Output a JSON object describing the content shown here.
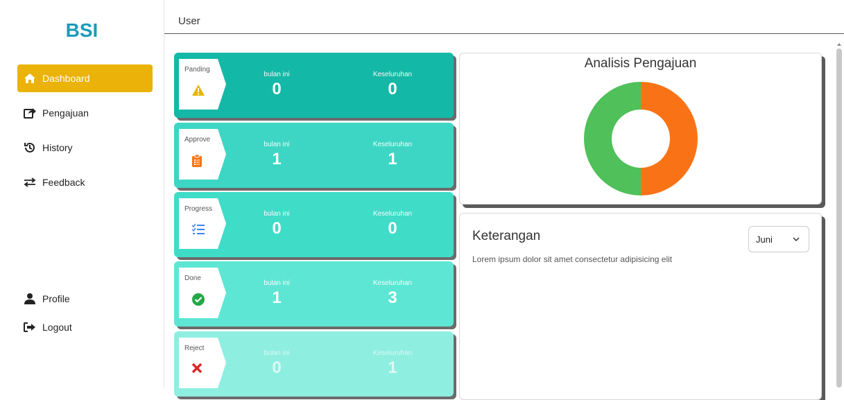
{
  "app": {
    "logo": "BSI",
    "user": "User"
  },
  "sidebar": {
    "items": [
      {
        "label": "Dashboard",
        "icon": "home-icon",
        "active": true
      },
      {
        "label": "Pengajuan",
        "icon": "share-icon",
        "active": false
      },
      {
        "label": "History",
        "icon": "history-icon",
        "active": false
      },
      {
        "label": "Feedback",
        "icon": "exchange-icon",
        "active": false
      }
    ],
    "bottom": [
      {
        "label": "Profile",
        "icon": "user-icon"
      },
      {
        "label": "Logout",
        "icon": "logout-icon"
      }
    ]
  },
  "cards": [
    {
      "status": "Panding",
      "icon": "warning-icon",
      "month_label": "bulan ini",
      "month_value": "0",
      "total_label": "Keseluruhan",
      "total_value": "0",
      "color": "#14b8a6"
    },
    {
      "status": "Approve",
      "icon": "clipboard-icon",
      "month_label": "bulan ini",
      "month_value": "1",
      "total_label": "Keseluruhan",
      "total_value": "1",
      "color": "#3dd6c4"
    },
    {
      "status": "Progress",
      "icon": "checklist-icon",
      "month_label": "bulan ini",
      "month_value": "0",
      "total_label": "Keseluruhan",
      "total_value": "0",
      "color": "#3fdcc8"
    },
    {
      "status": "Done",
      "icon": "check-circle-icon",
      "month_label": "bulan ini",
      "month_value": "1",
      "total_label": "Keseluruhan",
      "total_value": "3",
      "color": "#5ee6d4"
    },
    {
      "status": "Reject",
      "icon": "x-icon",
      "month_label": "bulan ini",
      "month_value": "0",
      "total_label": "Keseluruhan",
      "total_value": "1",
      "color": "#8eeee0"
    }
  ],
  "analysis": {
    "title": "Analisis Pengajuan"
  },
  "chart_data": {
    "type": "pie",
    "title": "Analisis Pengajuan",
    "categories": [
      "",
      ""
    ],
    "values": [
      50,
      50
    ],
    "colors": [
      "#f97316",
      "#4fc05a"
    ]
  },
  "keterangan": {
    "title": "Keterangan",
    "description": "Lorem ipsum dolor sit amet consectetur adipisicing elit",
    "month_select": "Juni"
  }
}
